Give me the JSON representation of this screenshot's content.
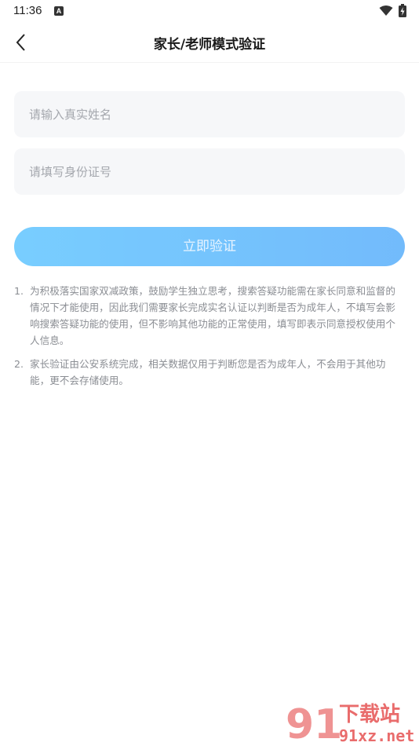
{
  "status": {
    "time": "11:36",
    "badge": "A"
  },
  "nav": {
    "title": "家长/老师模式验证"
  },
  "form": {
    "name_placeholder": "请输入真实姓名",
    "id_placeholder": "请填写身份证号",
    "submit_label": "立即验证"
  },
  "notes": [
    {
      "num": "1.",
      "text": "为积极落实国家双减政策，鼓励学生独立思考，搜索答疑功能需在家长同意和监督的情况下才能使用，因此我们需要家长完成实名认证以判断是否为成年人，不填写会影响搜索答疑功能的使用，但不影响其他功能的正常使用，填写即表示同意授权使用个人信息。"
    },
    {
      "num": "2.",
      "text": "家长验证由公安系统完成，相关数据仅用于判断您是否为成年人，不会用于其他功能，更不会存储使用。"
    }
  ],
  "watermark": {
    "logo": "91",
    "text_top": "下载站",
    "text_bottom": "91xz.net"
  },
  "colors": {
    "accent_start": "#71cbff",
    "accent_end": "#6bb7fb",
    "field_bg": "#f6f7f9",
    "watermark": "#e23b3b"
  }
}
